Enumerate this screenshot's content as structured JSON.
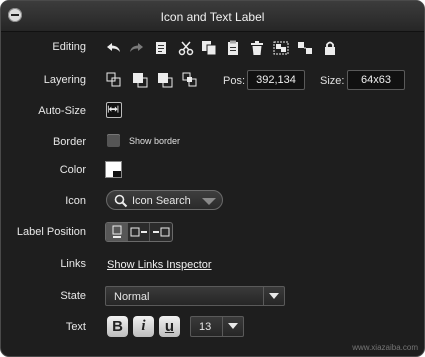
{
  "window": {
    "title": "Icon and Text Label"
  },
  "rows": {
    "editing": "Editing",
    "layering": "Layering",
    "auto_size": "Auto-Size",
    "border": "Border",
    "color": "Color",
    "icon": "Icon",
    "label_position": "Label Position",
    "links": "Links",
    "state": "State",
    "text": "Text"
  },
  "editing_icons": [
    "undo-icon",
    "redo-icon",
    "copy-style-icon",
    "cut-icon",
    "copy-icon",
    "paste-icon",
    "delete-icon",
    "group-icon",
    "ungroup-icon",
    "lock-icon"
  ],
  "layering_icons": [
    "bring-to-front-icon",
    "send-backward-icon",
    "bring-forward-icon",
    "send-to-back-icon"
  ],
  "geometry": {
    "pos_label": "Pos:",
    "pos_value": "392,134",
    "size_label": "Size:",
    "size_value": "64x63"
  },
  "border": {
    "checkbox_label": "Show border",
    "checked": false
  },
  "color": {
    "swatch": "#ffffff"
  },
  "icon_search": {
    "label": "Icon Search"
  },
  "label_position": {
    "options": [
      "label-below-icon",
      "label-right-icon",
      "label-left-icon"
    ],
    "selected_index": 0
  },
  "links": {
    "inspector_link": "Show Links Inspector"
  },
  "state": {
    "value": "Normal"
  },
  "text": {
    "bold": "B",
    "italic": "i",
    "underline": "u",
    "font_size": "13"
  },
  "watermark": "www.xiazaiba.com"
}
